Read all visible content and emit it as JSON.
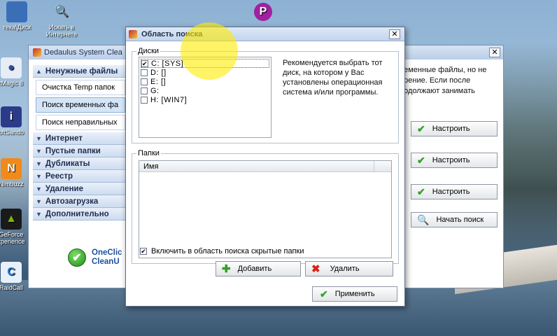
{
  "desktop": {
    "icons": [
      {
        "label": "тека\\Диск",
        "symbol": "",
        "color": "#3a6fb8"
      },
      {
        "label": "Искать в",
        "label2": "Интернете",
        "symbol": "🔍",
        "color": "#e07a1a"
      },
      {
        "label": "",
        "symbol": "P",
        "color": "#a020a0"
      },
      {
        "label": "tMagic 8",
        "symbol": "●",
        "color": "#2c4fa0"
      },
      {
        "label": "oftSandb",
        "symbol": "i",
        "color": "#2c3a8a"
      },
      {
        "label": "Nimbuzz",
        "symbol": "N",
        "color": "#f08a1a"
      },
      {
        "label": "GeForce",
        "label2": "xperience",
        "symbol": "▲",
        "color": "#3c8a2a"
      },
      {
        "label": "RaidCall",
        "symbol": "C",
        "color": "#2a7ad0"
      }
    ]
  },
  "bg_window": {
    "title": "Dedaulus System Clea",
    "close": "✕",
    "sidebar": {
      "groups": [
        {
          "label": "Ненужные файлы",
          "arrow": "▲"
        },
        {
          "label": "Интернет",
          "arrow": "▼"
        },
        {
          "label": "Пустые папки",
          "arrow": "▼"
        },
        {
          "label": "Дубликаты",
          "arrow": "▼"
        },
        {
          "label": "Реестр",
          "arrow": "▼"
        },
        {
          "label": "Удаление",
          "arrow": "▼"
        },
        {
          "label": "Автозагрузка",
          "arrow": "▼"
        },
        {
          "label": "Дополнительно",
          "arrow": "▼"
        }
      ],
      "subitems": [
        "Очистка Temp папок",
        "Поиск временных фа",
        "Поиск неправильных"
      ]
    },
    "right_text": "ременные файлы, но не\nирение. Если после\nродолжают занимать",
    "buttons": [
      {
        "label": "Настроить",
        "icon": "check"
      },
      {
        "label": "Настроить",
        "icon": "check"
      },
      {
        "label": "Настроить",
        "icon": "check"
      },
      {
        "label": "Начать поиск",
        "icon": "search"
      }
    ],
    "oneclick": {
      "line1": "OneClic",
      "line2": "CleanU"
    }
  },
  "dialog": {
    "title": "Область поиска",
    "close": "✕",
    "drives_label": "Диски",
    "drives": [
      {
        "label": "C: [SYS]",
        "checked": true
      },
      {
        "label": "D: []",
        "checked": false
      },
      {
        "label": "E: []",
        "checked": false
      },
      {
        "label": "G:",
        "checked": false
      },
      {
        "label": "H: [WIN7]",
        "checked": false
      }
    ],
    "drives_hint": "Рекомендуется выбрать тот диск, на котором у Вас установлены операционная система и/или программы.",
    "folders_label": "Папки",
    "folders_column": "Имя",
    "include_hidden_label": "Включить в область поиска скрытые папки",
    "include_hidden_checked": true,
    "add_button": "Добавить",
    "remove_button": "Удалить",
    "apply_button": "Применить"
  }
}
